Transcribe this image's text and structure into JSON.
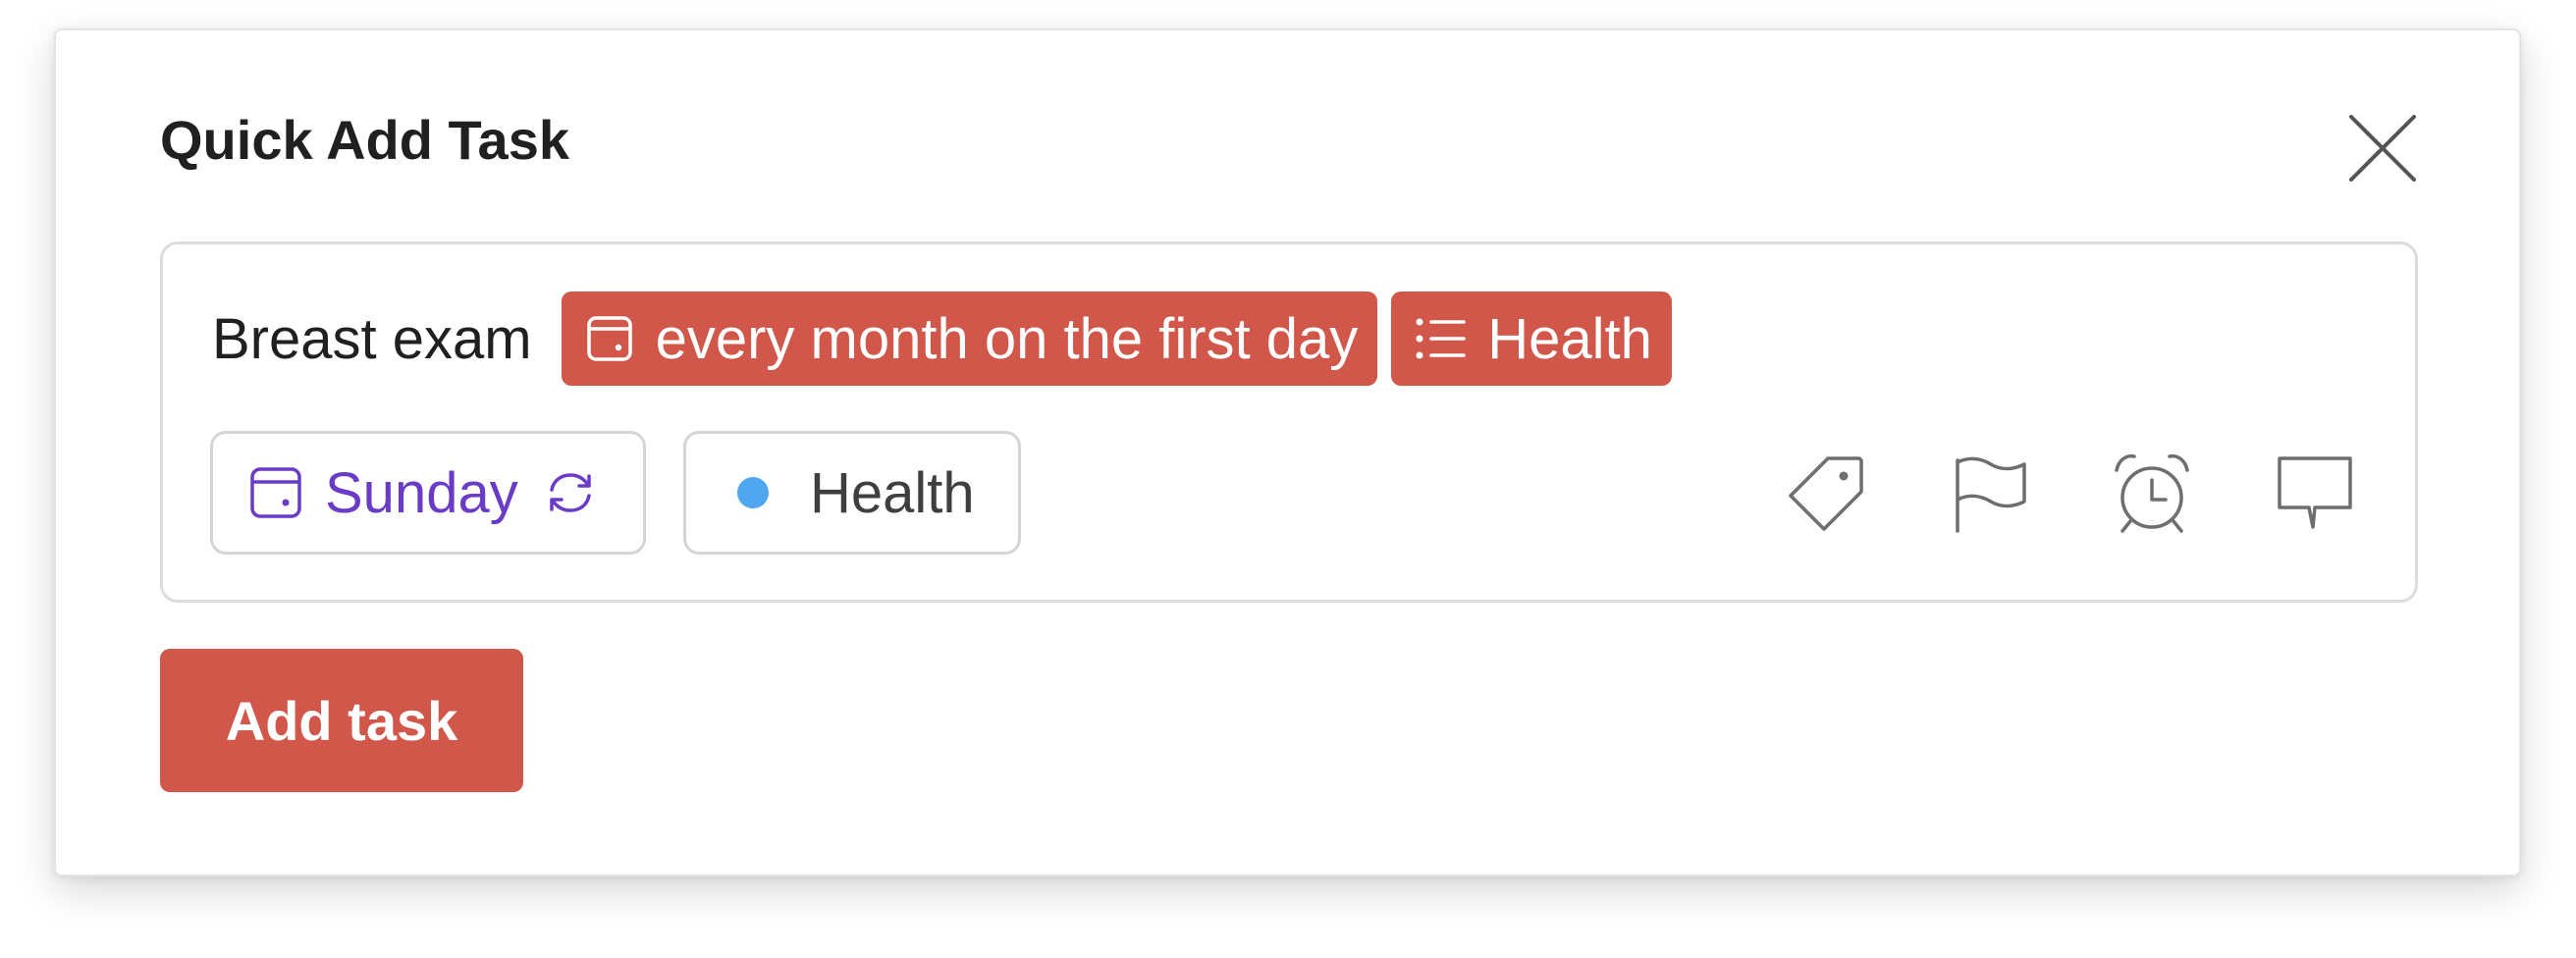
{
  "dialog": {
    "title": "Quick Add Task"
  },
  "editor": {
    "task_name": "Breast exam",
    "tokens": [
      {
        "icon": "calendar-icon",
        "label": "every month on the first day"
      },
      {
        "icon": "list-icon",
        "label": "Health"
      }
    ],
    "due_chip": {
      "label": "Sunday",
      "icon": "calendar-icon",
      "repeat_icon": "repeat-icon"
    },
    "project_chip": {
      "label": "Health",
      "dot_color": "#4fa8ef"
    },
    "actions": [
      "label-tag-icon",
      "priority-flag-icon",
      "reminder-alarm-icon",
      "comment-icon"
    ]
  },
  "footer": {
    "add_label": "Add task"
  },
  "colors": {
    "accent": "#d1574a",
    "date_text": "#6a3bc7",
    "project_dot": "#4fa8ef"
  }
}
